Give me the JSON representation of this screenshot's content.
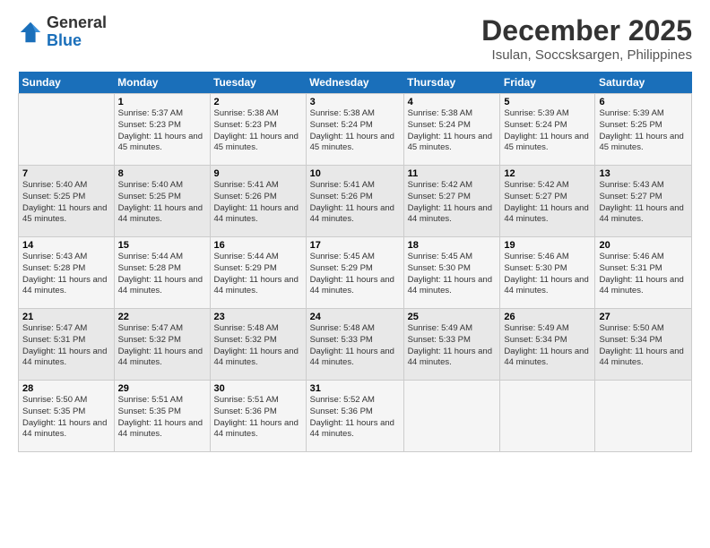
{
  "logo": {
    "general": "General",
    "blue": "Blue"
  },
  "title": "December 2025",
  "location": "Isulan, Soccsksargen, Philippines",
  "days_header": [
    "Sunday",
    "Monday",
    "Tuesday",
    "Wednesday",
    "Thursday",
    "Friday",
    "Saturday"
  ],
  "weeks": [
    [
      {
        "day": "",
        "sunrise": "",
        "sunset": "",
        "daylight": ""
      },
      {
        "day": "1",
        "sunrise": "Sunrise: 5:37 AM",
        "sunset": "Sunset: 5:23 PM",
        "daylight": "Daylight: 11 hours and 45 minutes."
      },
      {
        "day": "2",
        "sunrise": "Sunrise: 5:38 AM",
        "sunset": "Sunset: 5:23 PM",
        "daylight": "Daylight: 11 hours and 45 minutes."
      },
      {
        "day": "3",
        "sunrise": "Sunrise: 5:38 AM",
        "sunset": "Sunset: 5:24 PM",
        "daylight": "Daylight: 11 hours and 45 minutes."
      },
      {
        "day": "4",
        "sunrise": "Sunrise: 5:38 AM",
        "sunset": "Sunset: 5:24 PM",
        "daylight": "Daylight: 11 hours and 45 minutes."
      },
      {
        "day": "5",
        "sunrise": "Sunrise: 5:39 AM",
        "sunset": "Sunset: 5:24 PM",
        "daylight": "Daylight: 11 hours and 45 minutes."
      },
      {
        "day": "6",
        "sunrise": "Sunrise: 5:39 AM",
        "sunset": "Sunset: 5:25 PM",
        "daylight": "Daylight: 11 hours and 45 minutes."
      }
    ],
    [
      {
        "day": "7",
        "sunrise": "Sunrise: 5:40 AM",
        "sunset": "Sunset: 5:25 PM",
        "daylight": "Daylight: 11 hours and 45 minutes."
      },
      {
        "day": "8",
        "sunrise": "Sunrise: 5:40 AM",
        "sunset": "Sunset: 5:25 PM",
        "daylight": "Daylight: 11 hours and 44 minutes."
      },
      {
        "day": "9",
        "sunrise": "Sunrise: 5:41 AM",
        "sunset": "Sunset: 5:26 PM",
        "daylight": "Daylight: 11 hours and 44 minutes."
      },
      {
        "day": "10",
        "sunrise": "Sunrise: 5:41 AM",
        "sunset": "Sunset: 5:26 PM",
        "daylight": "Daylight: 11 hours and 44 minutes."
      },
      {
        "day": "11",
        "sunrise": "Sunrise: 5:42 AM",
        "sunset": "Sunset: 5:27 PM",
        "daylight": "Daylight: 11 hours and 44 minutes."
      },
      {
        "day": "12",
        "sunrise": "Sunrise: 5:42 AM",
        "sunset": "Sunset: 5:27 PM",
        "daylight": "Daylight: 11 hours and 44 minutes."
      },
      {
        "day": "13",
        "sunrise": "Sunrise: 5:43 AM",
        "sunset": "Sunset: 5:27 PM",
        "daylight": "Daylight: 11 hours and 44 minutes."
      }
    ],
    [
      {
        "day": "14",
        "sunrise": "Sunrise: 5:43 AM",
        "sunset": "Sunset: 5:28 PM",
        "daylight": "Daylight: 11 hours and 44 minutes."
      },
      {
        "day": "15",
        "sunrise": "Sunrise: 5:44 AM",
        "sunset": "Sunset: 5:28 PM",
        "daylight": "Daylight: 11 hours and 44 minutes."
      },
      {
        "day": "16",
        "sunrise": "Sunrise: 5:44 AM",
        "sunset": "Sunset: 5:29 PM",
        "daylight": "Daylight: 11 hours and 44 minutes."
      },
      {
        "day": "17",
        "sunrise": "Sunrise: 5:45 AM",
        "sunset": "Sunset: 5:29 PM",
        "daylight": "Daylight: 11 hours and 44 minutes."
      },
      {
        "day": "18",
        "sunrise": "Sunrise: 5:45 AM",
        "sunset": "Sunset: 5:30 PM",
        "daylight": "Daylight: 11 hours and 44 minutes."
      },
      {
        "day": "19",
        "sunrise": "Sunrise: 5:46 AM",
        "sunset": "Sunset: 5:30 PM",
        "daylight": "Daylight: 11 hours and 44 minutes."
      },
      {
        "day": "20",
        "sunrise": "Sunrise: 5:46 AM",
        "sunset": "Sunset: 5:31 PM",
        "daylight": "Daylight: 11 hours and 44 minutes."
      }
    ],
    [
      {
        "day": "21",
        "sunrise": "Sunrise: 5:47 AM",
        "sunset": "Sunset: 5:31 PM",
        "daylight": "Daylight: 11 hours and 44 minutes."
      },
      {
        "day": "22",
        "sunrise": "Sunrise: 5:47 AM",
        "sunset": "Sunset: 5:32 PM",
        "daylight": "Daylight: 11 hours and 44 minutes."
      },
      {
        "day": "23",
        "sunrise": "Sunrise: 5:48 AM",
        "sunset": "Sunset: 5:32 PM",
        "daylight": "Daylight: 11 hours and 44 minutes."
      },
      {
        "day": "24",
        "sunrise": "Sunrise: 5:48 AM",
        "sunset": "Sunset: 5:33 PM",
        "daylight": "Daylight: 11 hours and 44 minutes."
      },
      {
        "day": "25",
        "sunrise": "Sunrise: 5:49 AM",
        "sunset": "Sunset: 5:33 PM",
        "daylight": "Daylight: 11 hours and 44 minutes."
      },
      {
        "day": "26",
        "sunrise": "Sunrise: 5:49 AM",
        "sunset": "Sunset: 5:34 PM",
        "daylight": "Daylight: 11 hours and 44 minutes."
      },
      {
        "day": "27",
        "sunrise": "Sunrise: 5:50 AM",
        "sunset": "Sunset: 5:34 PM",
        "daylight": "Daylight: 11 hours and 44 minutes."
      }
    ],
    [
      {
        "day": "28",
        "sunrise": "Sunrise: 5:50 AM",
        "sunset": "Sunset: 5:35 PM",
        "daylight": "Daylight: 11 hours and 44 minutes."
      },
      {
        "day": "29",
        "sunrise": "Sunrise: 5:51 AM",
        "sunset": "Sunset: 5:35 PM",
        "daylight": "Daylight: 11 hours and 44 minutes."
      },
      {
        "day": "30",
        "sunrise": "Sunrise: 5:51 AM",
        "sunset": "Sunset: 5:36 PM",
        "daylight": "Daylight: 11 hours and 44 minutes."
      },
      {
        "day": "31",
        "sunrise": "Sunrise: 5:52 AM",
        "sunset": "Sunset: 5:36 PM",
        "daylight": "Daylight: 11 hours and 44 minutes."
      },
      {
        "day": "",
        "sunrise": "",
        "sunset": "",
        "daylight": ""
      },
      {
        "day": "",
        "sunrise": "",
        "sunset": "",
        "daylight": ""
      },
      {
        "day": "",
        "sunrise": "",
        "sunset": "",
        "daylight": ""
      }
    ]
  ]
}
